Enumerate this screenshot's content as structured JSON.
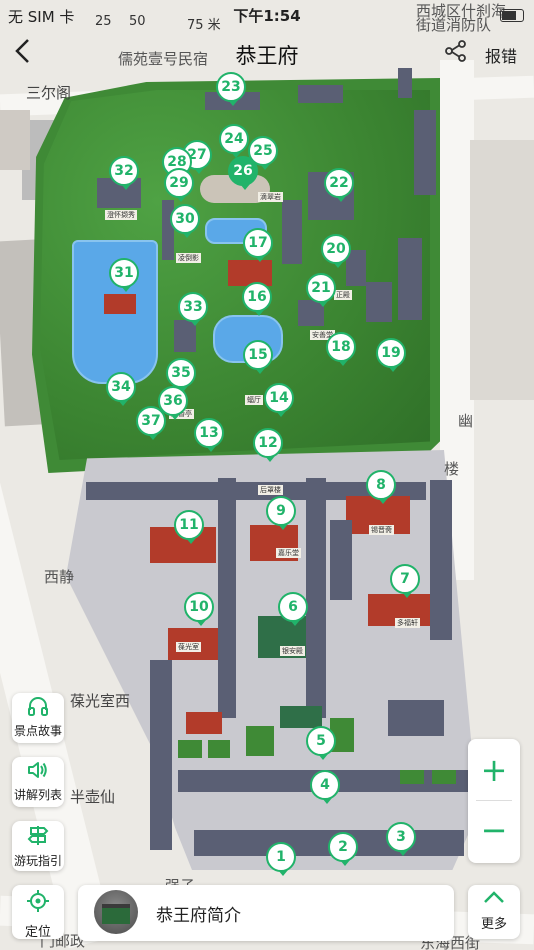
{
  "status_bar": {
    "carrier": "无 SIM 卡",
    "time": "下午1:54"
  },
  "scale": {
    "ticks": [
      "25",
      "50",
      "75 米"
    ]
  },
  "nav": {
    "back_icon": "chevron-left-icon",
    "title": "恭王府",
    "share_icon": "share-icon",
    "report_label": "报错"
  },
  "map_labels": {
    "top_hostel": "儒苑壹号民宿",
    "top_right": "西城区什刹海",
    "top_right2": "街道消防队",
    "sanerge": "三尔阁",
    "xijing": "西静",
    "yuyou": "幽",
    "lou": "楼",
    "baoguang": "葆光室西",
    "banhuxian": "半壶仙",
    "qiangzi": "强子",
    "bottom_left": "门邮政",
    "bottom_right": "东海西街"
  },
  "pins": [
    "1",
    "2",
    "3",
    "4",
    "5",
    "6",
    "7",
    "8",
    "9",
    "10",
    "11",
    "12",
    "13",
    "14",
    "15",
    "16",
    "17",
    "18",
    "19",
    "20",
    "21",
    "22",
    "23",
    "24",
    "25",
    "26",
    "27",
    "28",
    "29",
    "30",
    "31",
    "32",
    "33",
    "34",
    "35",
    "36",
    "37"
  ],
  "building_tags": [
    "滴翠岩",
    "妙香亭",
    "安善堂",
    "蝠厅",
    "凌倒影",
    "澄怀撷秀",
    "正殿",
    "多福轩",
    "锡晋斋",
    "葆光室",
    "嘉乐堂",
    "后罩楼",
    "银安殿"
  ],
  "tools": [
    {
      "icon": "headphones-icon",
      "label": "景点故事"
    },
    {
      "icon": "speaker-icon",
      "label": "讲解列表"
    },
    {
      "icon": "signpost-icon",
      "label": "游玩指引"
    }
  ],
  "zoom": {
    "in": "+",
    "out": "−"
  },
  "bottom": {
    "locate_icon": "crosshair-icon",
    "locate_label": "定位",
    "intro_label": "恭王府简介",
    "more_icon": "chevron-up-icon",
    "more_label": "更多"
  }
}
